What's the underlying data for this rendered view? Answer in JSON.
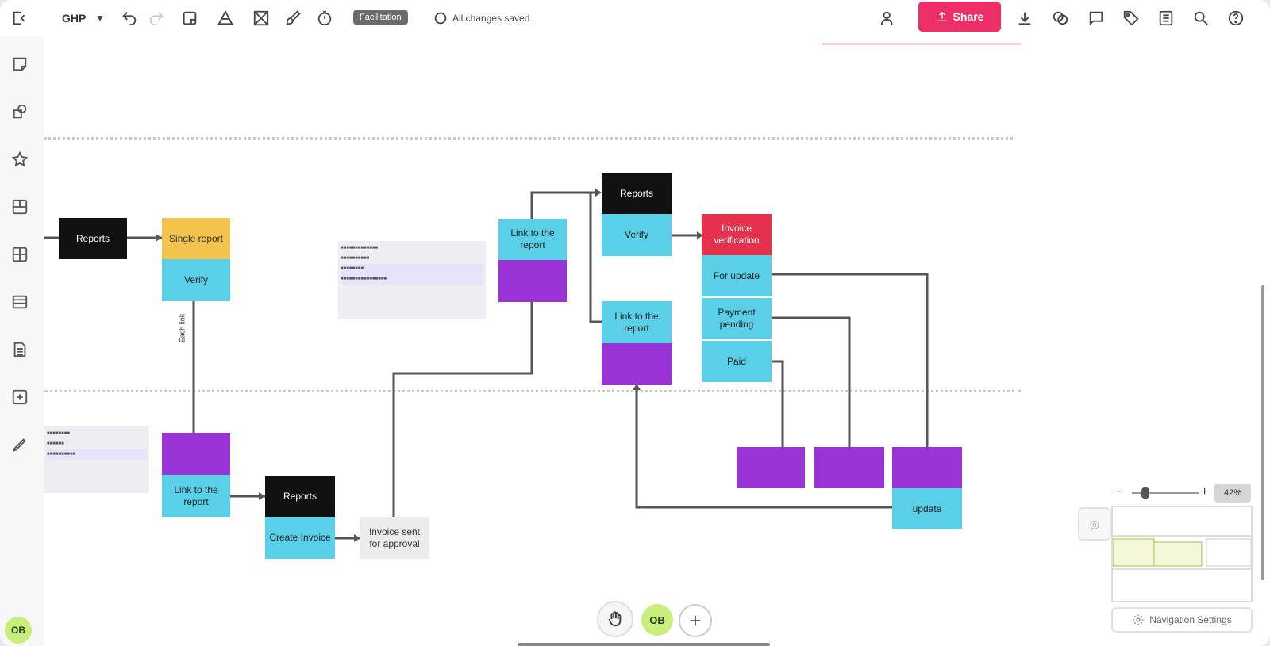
{
  "topbar": {
    "board_name": "GHP",
    "badge": "Facilitation",
    "save_status": "All changes saved",
    "share_label": "Share"
  },
  "user": {
    "initials": "OB"
  },
  "nodes": {
    "reports_left": "Reports",
    "single_report": "Single report",
    "verify_left": "Verify",
    "rotated_label": "Each link",
    "link_left": "Link to the report",
    "reports_bottom": "Reports",
    "create_invoice": "Create Invoice",
    "invoice_sent": "Invoice sent for approval",
    "link_top": "Link to the report",
    "link_mid": "Link to the report",
    "reports_top": "Reports",
    "verify_top": "Verify",
    "invoice_verification": "Invoice verification",
    "for_update": "For update",
    "payment_pending": "Payment pending",
    "paid": "Paid",
    "update": "update"
  },
  "zoom": {
    "level": "42%"
  },
  "navigation": {
    "settings_label": "Navigation Settings"
  },
  "icons": {
    "collapse": "collapse-sidebar-icon",
    "undo": "undo-icon",
    "redo": "redo-icon",
    "share_export": "upload-icon",
    "download": "download-icon"
  },
  "colors": {
    "share": "#ee2e66",
    "black_card": "#111111",
    "yellow_card": "#f3c44d",
    "cyan_card": "#5ad0e8",
    "purple_card": "#9b34d6",
    "red_card": "#e5304e",
    "avatar": "#c8ef7c"
  }
}
